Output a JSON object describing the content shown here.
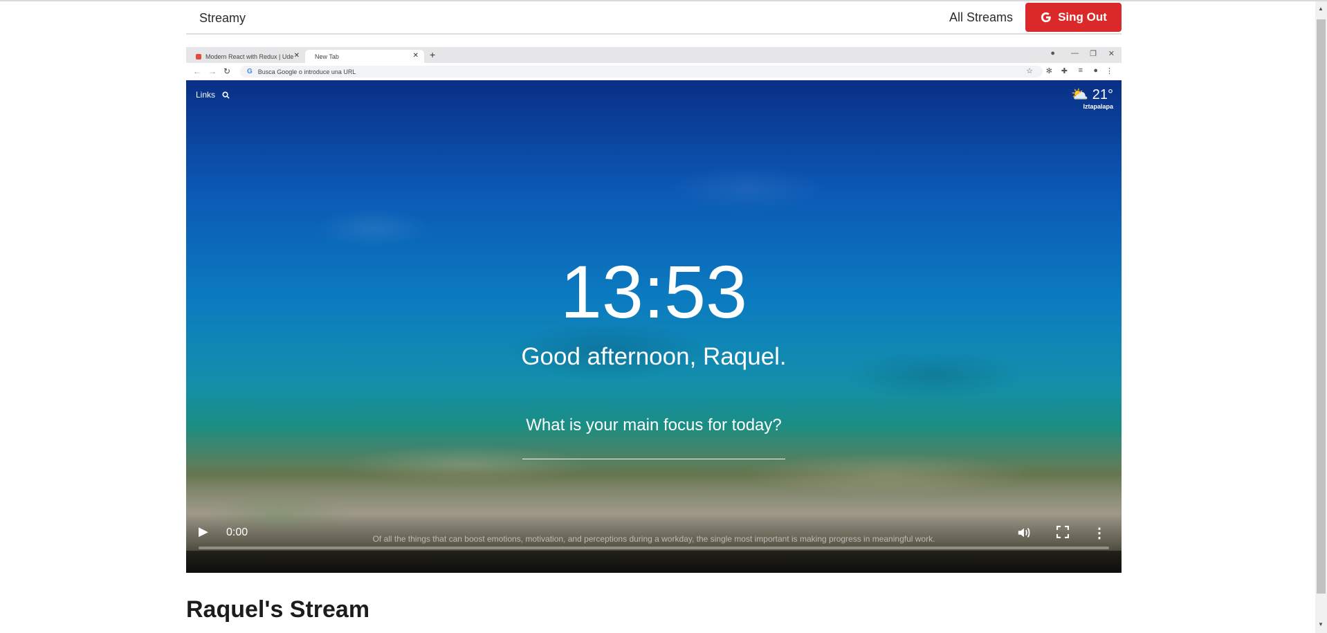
{
  "navbar": {
    "brand": "Streamy",
    "all_streams": "All Streams",
    "signout_label": "Sing Out"
  },
  "video": {
    "inner_browser": {
      "tab1_title": "Modern React with Redux | Ude",
      "tab2_title": "New Tab",
      "omnibox_placeholder": "Busca Google o introduce una URL"
    },
    "momentum": {
      "links_label": "Links",
      "temperature": "21°",
      "location": "Iztapalapa",
      "clock": "13:53",
      "greeting": "Good afternoon, Raquel.",
      "focus_prompt": "What is your main focus for today?",
      "quote": "Of all the things that can boost emotions, motivation, and perceptions during a workday, the single most important is making progress in meaningful work."
    },
    "controls": {
      "time": "0:00",
      "progress": 0
    }
  },
  "stream": {
    "title": "Raquel's Stream"
  },
  "colors": {
    "signout_bg": "#db2828"
  }
}
